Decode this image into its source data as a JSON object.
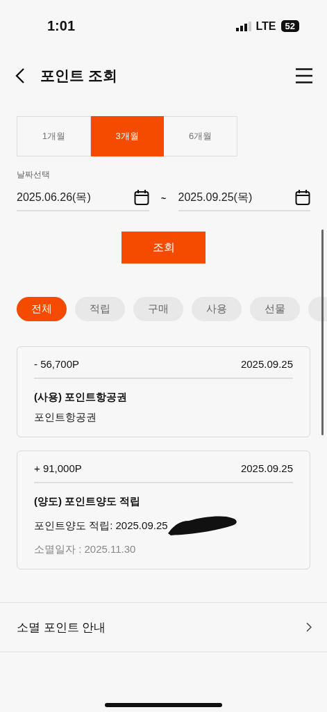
{
  "status_bar": {
    "time": "1:01",
    "network": "LTE",
    "battery": "52"
  },
  "header": {
    "title": "포인트 조회"
  },
  "period_tabs": [
    {
      "label": "1개월",
      "selected": false
    },
    {
      "label": "3개월",
      "selected": true
    },
    {
      "label": "6개월",
      "selected": false
    }
  ],
  "date_range": {
    "label": "날짜선택",
    "start": "2025.06.26(목)",
    "separator": "~",
    "end": "2025.09.25(목)"
  },
  "search_button": "조회",
  "filter_chips": [
    {
      "label": "전체",
      "selected": true
    },
    {
      "label": "적립",
      "selected": false
    },
    {
      "label": "구매",
      "selected": false
    },
    {
      "label": "사용",
      "selected": false
    },
    {
      "label": "선물",
      "selected": false
    },
    {
      "selected": false
    }
  ],
  "history": [
    {
      "amount": "- 56,700P",
      "date": "2025.09.25",
      "title": "(사용) 포인트항공권",
      "detail": "포인트항공권",
      "redacted": false
    },
    {
      "amount": "+ 91,000P",
      "date": "2025.09.25",
      "title": "(양도) 포인트양도 적립",
      "detail": "포인트양도 적립: 2025.09.25",
      "redacted": true,
      "expiry": "소멸일자 : 2025.11.30"
    }
  ],
  "links": [
    {
      "label": "소멸 포인트 안내"
    }
  ]
}
